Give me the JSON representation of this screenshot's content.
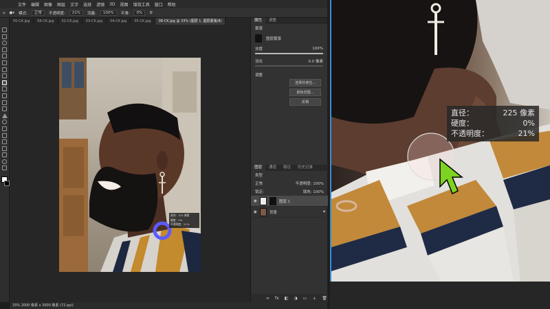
{
  "menu": {
    "items": [
      "文件",
      "编辑",
      "图像",
      "图层",
      "文字",
      "选择",
      "滤镜",
      "3D",
      "视图",
      "增效工具",
      "窗口",
      "帮助"
    ]
  },
  "options": {
    "mode_label": "模式:",
    "mode_value": "正常",
    "opacity_label": "不透明度:",
    "opacity_value": "21%",
    "flow_label": "流量:",
    "flow_value": "100%",
    "smooth_label": "平滑:",
    "smooth_value": "0%"
  },
  "tabs": [
    "05-CK.jpg",
    "06-CK.jpg",
    "02-CK.jpg",
    "03-CK.jpg",
    "04-CK.jpg",
    "05-CK.jpg",
    "08-CK.jpg @ 33% (图层 1, 图层蒙版/8)"
  ],
  "properties": {
    "tab_labels": [
      "属性",
      "调整"
    ],
    "title": "蒙版",
    "layer_mask_label": "图层蒙版",
    "density_label": "浓度",
    "density_value": "100%",
    "feather_label": "羽化",
    "feather_value": "0.0 像素",
    "refine_label": "调整",
    "buttons": [
      "选择并遮住...",
      "颜色范围...",
      "反相"
    ]
  },
  "layers": {
    "tab_labels": [
      "图层",
      "通道",
      "路径",
      "历史记录"
    ],
    "kind_label": "类型",
    "blend_value": "正常",
    "opacity_label": "不透明度:",
    "opacity_value": "100%",
    "lock_label": "锁定:",
    "fill_label": "填充:",
    "fill_value": "100%",
    "items": [
      {
        "name": "图层 1"
      },
      {
        "name": "背景"
      }
    ]
  },
  "status": {
    "zoom": "33%",
    "info": "2000 像素 x 3000 像素 (72 ppi)"
  },
  "hud": {
    "diameter_label": "直径：",
    "diameter_value": "225 像素",
    "hardness_label": "硬度：",
    "hardness_value": "0%",
    "opacity_label": "不透明度：",
    "opacity_value": "21%"
  },
  "small_hud": {
    "line1": "直径：225 像素",
    "line2": "硬度：0%",
    "line3": "不透明度：21%"
  },
  "colors": {
    "accent": "#3d8fd6",
    "cursor": "#7ed321",
    "brush_ring": "#5b5bff"
  }
}
